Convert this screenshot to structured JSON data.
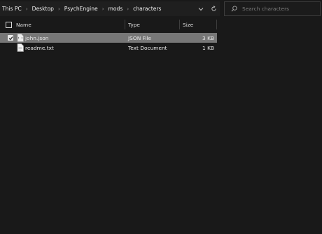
{
  "breadcrumb": [
    "This PC",
    "Desktop",
    "PsychEngine",
    "mods",
    "characters"
  ],
  "address_bar": {
    "dropdown_icon": "chevron-down-icon",
    "refresh_icon": "refresh-icon"
  },
  "search": {
    "placeholder": "Search characters",
    "value": ""
  },
  "columns": {
    "name": "Name",
    "type": "Type",
    "size": "Size"
  },
  "files": [
    {
      "name": "john.json",
      "type": "JSON File",
      "size": "3 KB",
      "selected": true,
      "checked": true
    },
    {
      "name": "readme.txt",
      "type": "Text Document",
      "size": "1 KB",
      "selected": false,
      "checked": false
    }
  ],
  "colors": {
    "background": "#191919",
    "selection": "#777777",
    "text": "#eaeaea"
  }
}
